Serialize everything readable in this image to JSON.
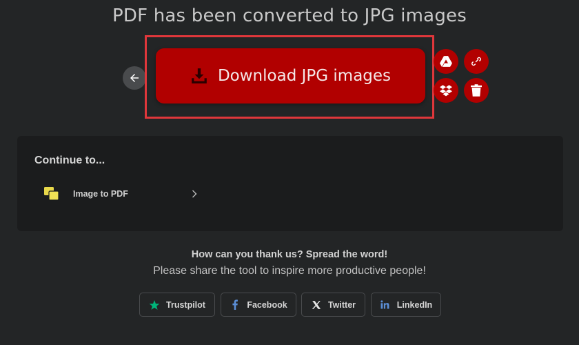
{
  "header": {
    "title": "PDF has been converted to JPG images"
  },
  "download": {
    "label": "Download JPG images",
    "icon": "download-icon"
  },
  "actions": {
    "google_drive": "google-drive-icon",
    "link": "link-icon",
    "dropbox": "dropbox-icon",
    "delete": "trash-icon"
  },
  "continue": {
    "heading": "Continue to...",
    "items": [
      {
        "label": "Image to PDF",
        "icon": "image-to-pdf-icon"
      }
    ]
  },
  "share": {
    "title": "How can you thank us? Spread the word!",
    "subtitle": "Please share the tool to inspire more productive people!",
    "buttons": [
      {
        "label": "Trustpilot",
        "icon": "trustpilot-star-icon"
      },
      {
        "label": "Facebook",
        "icon": "facebook-icon"
      },
      {
        "label": "Twitter",
        "icon": "x-twitter-icon"
      },
      {
        "label": "LinkedIn",
        "icon": "linkedin-icon"
      }
    ]
  },
  "colors": {
    "background": "#232526",
    "accent": "#b10000",
    "highlight": "#e0373b",
    "card": "#1b1c1d",
    "trustpilot": "#00b67a",
    "social_blue": "#5b8ed6"
  }
}
